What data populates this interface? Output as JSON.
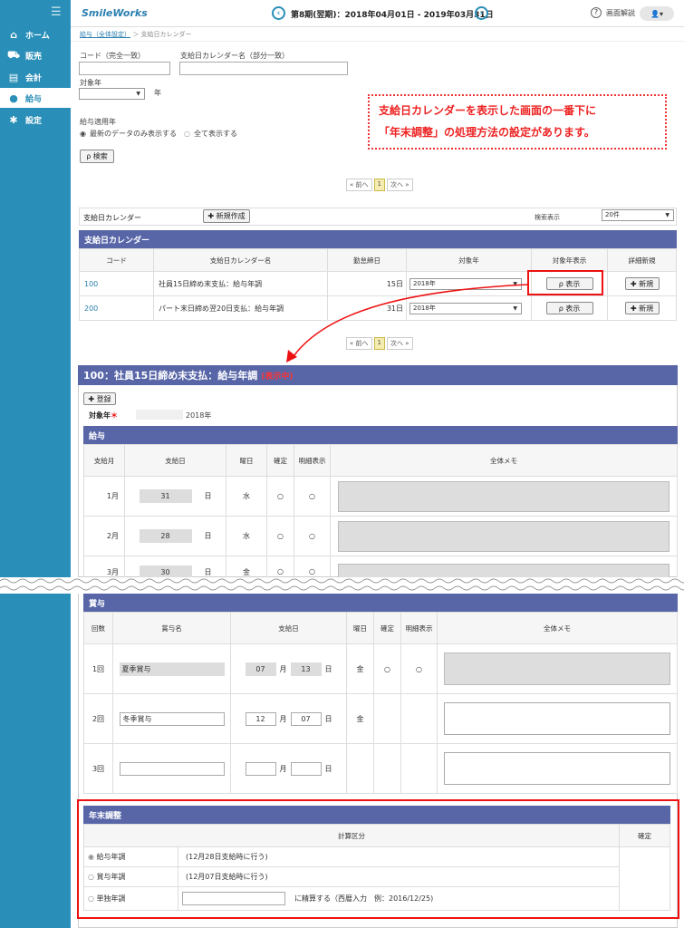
{
  "sidebar": {
    "menu_icon": "hamburger-icon",
    "items": [
      {
        "label": "ホーム",
        "icon": "home-icon",
        "glyph": "⌂"
      },
      {
        "label": "販売",
        "icon": "cart-icon",
        "glyph": "🛒"
      },
      {
        "label": "会計",
        "icon": "ledger-icon",
        "glyph": "▤"
      },
      {
        "label": "給与",
        "icon": "moneybag-icon",
        "glyph": "●"
      },
      {
        "label": "設定",
        "icon": "gear-icon",
        "glyph": "✱"
      }
    ]
  },
  "header": {
    "logo": "SmileWorks",
    "period": "第8期(翌期)：2018年04月01日 - 2019年03月31日",
    "prev": "‹",
    "next": "›",
    "help": "画面解説",
    "help_glyph": "?",
    "user": "👤▾"
  },
  "breadcrumb": {
    "link": "給与（全体設定）",
    "sep": "＞",
    "current": "支給日カレンダー"
  },
  "search": {
    "code_label": "コード（完全一致）",
    "code_value": "",
    "name_label": "支給日カレンダー名（部分一致）",
    "name_value": "",
    "year_label": "対象年",
    "year_value": "",
    "year_unit": "年",
    "apply_label": "給与適用年",
    "radio1": "最新のデータのみ表示する",
    "radio2": "全て表示する",
    "button": "ρ 検索"
  },
  "notice": {
    "line1": "支給日カレンダーを表示した画面の一番下に",
    "line2": "「年末調整」の処理方法の設定があります。"
  },
  "pager": {
    "prev": "« 前へ",
    "page": "1",
    "next": "次へ »"
  },
  "list": {
    "title_label": "支給日カレンダー",
    "new_button": "✚ 新規作成",
    "display_label": "検索表示",
    "display_value": "20件",
    "header": "支給日カレンダー",
    "columns": [
      "コード",
      "支給日カレンダー名",
      "勤怠締日",
      "対象年",
      "対象年表示",
      "詳細新規"
    ],
    "rows": [
      {
        "code": "100",
        "name": "社員15日締め末支払：給与年調",
        "close": "15日",
        "year": "2018年",
        "show": "ρ 表示",
        "new": "✚ 新規"
      },
      {
        "code": "200",
        "name": "パート末日締め翌20日支払：給与年調",
        "close": "31日",
        "year": "2018年",
        "show": "ρ 表示",
        "new": "✚ 新規"
      }
    ]
  },
  "detail": {
    "title": "100：社員15日締め末支払：給与年調",
    "status": "(表示中)",
    "register": "✚ 登録",
    "target_label": "対象年",
    "required": "＊",
    "target_value": "2018年"
  },
  "salary": {
    "header": "給与",
    "columns": [
      "支給月",
      "支給日",
      "曜日",
      "確定",
      "明細表示",
      "全体メモ"
    ],
    "rows": [
      {
        "month": "1月",
        "day": "31",
        "unit": "日",
        "dow": "水",
        "c": "○",
        "m": "○"
      },
      {
        "month": "2月",
        "day": "28",
        "unit": "日",
        "dow": "水",
        "c": "○",
        "m": "○"
      },
      {
        "month": "3月",
        "day": "30",
        "unit": "日",
        "dow": "金",
        "c": "○",
        "m": "○"
      }
    ]
  },
  "bonus": {
    "header": "賞与",
    "columns": [
      "回数",
      "賞与名",
      "支給日",
      "曜日",
      "確定",
      "明細表示",
      "全体メモ"
    ],
    "rows": [
      {
        "n": "1回",
        "name": "夏季賞与",
        "mon": "07",
        "munit": "月",
        "day": "13",
        "dunit": "日",
        "dow": "金",
        "c": "○",
        "m": "○"
      },
      {
        "n": "2回",
        "name": "冬季賞与",
        "mon": "12",
        "munit": "月",
        "day": "07",
        "dunit": "日",
        "dow": "金",
        "c": "",
        "m": ""
      },
      {
        "n": "3回",
        "name": "",
        "mon": "",
        "munit": "月",
        "day": "",
        "dunit": "日",
        "dow": "",
        "c": "",
        "m": ""
      }
    ]
  },
  "yearend": {
    "header": "年末調整",
    "col1": "計算区分",
    "col2": "確定",
    "options": [
      {
        "label": "給与年調",
        "note": "(12月28日支給時に行う)"
      },
      {
        "label": "賞与年調",
        "note": "(12月07日支給時に行う)"
      },
      {
        "label": "単独年調",
        "note": "に精算する（西暦入力　例：2016/12/25)"
      }
    ]
  }
}
